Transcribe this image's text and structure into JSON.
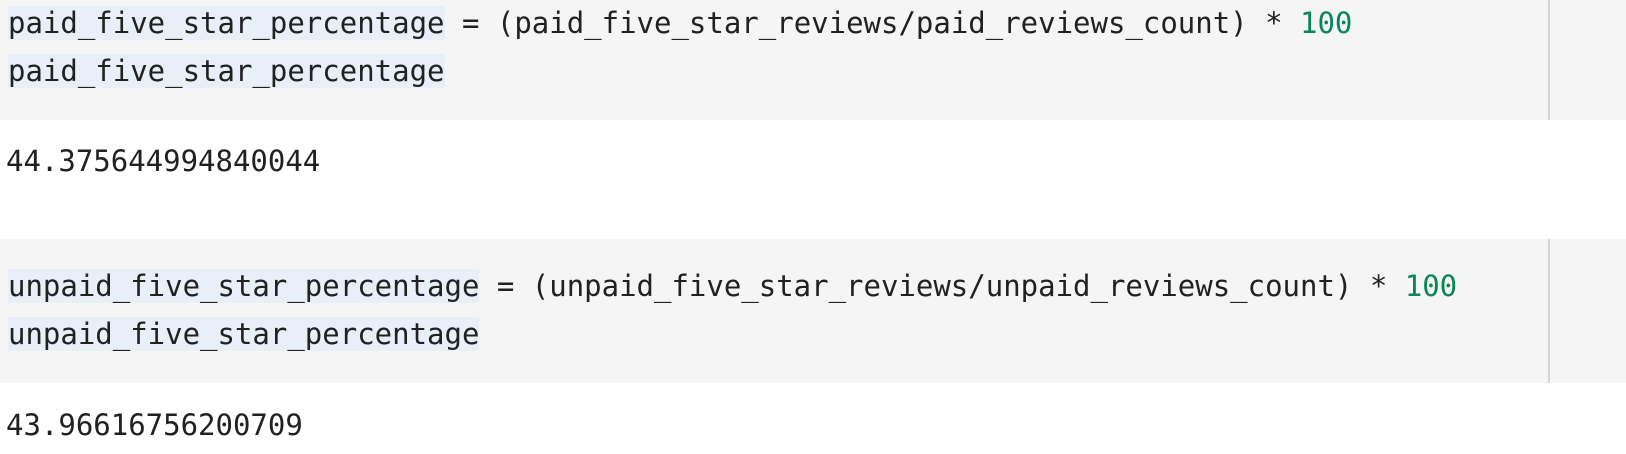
{
  "cells": [
    {
      "code": {
        "line1": {
          "var": "paid_five_star_percentage",
          "expr": " = (paid_five_star_reviews/paid_reviews_count) * ",
          "number": "100"
        },
        "line2": {
          "var": "paid_five_star_percentage"
        }
      },
      "output": "44.375644994840044"
    },
    {
      "code": {
        "line1": {
          "var": "unpaid_five_star_percentage",
          "expr": " = (unpaid_five_star_reviews/unpaid_reviews_count) * ",
          "number": "100"
        },
        "line2": {
          "var": "unpaid_five_star_percentage"
        }
      },
      "output": "43.96616756200709"
    }
  ],
  "colors": {
    "cell_background": "#f5f5f5",
    "highlight": "#e8eff8",
    "number": "#098658",
    "text": "#212121"
  }
}
